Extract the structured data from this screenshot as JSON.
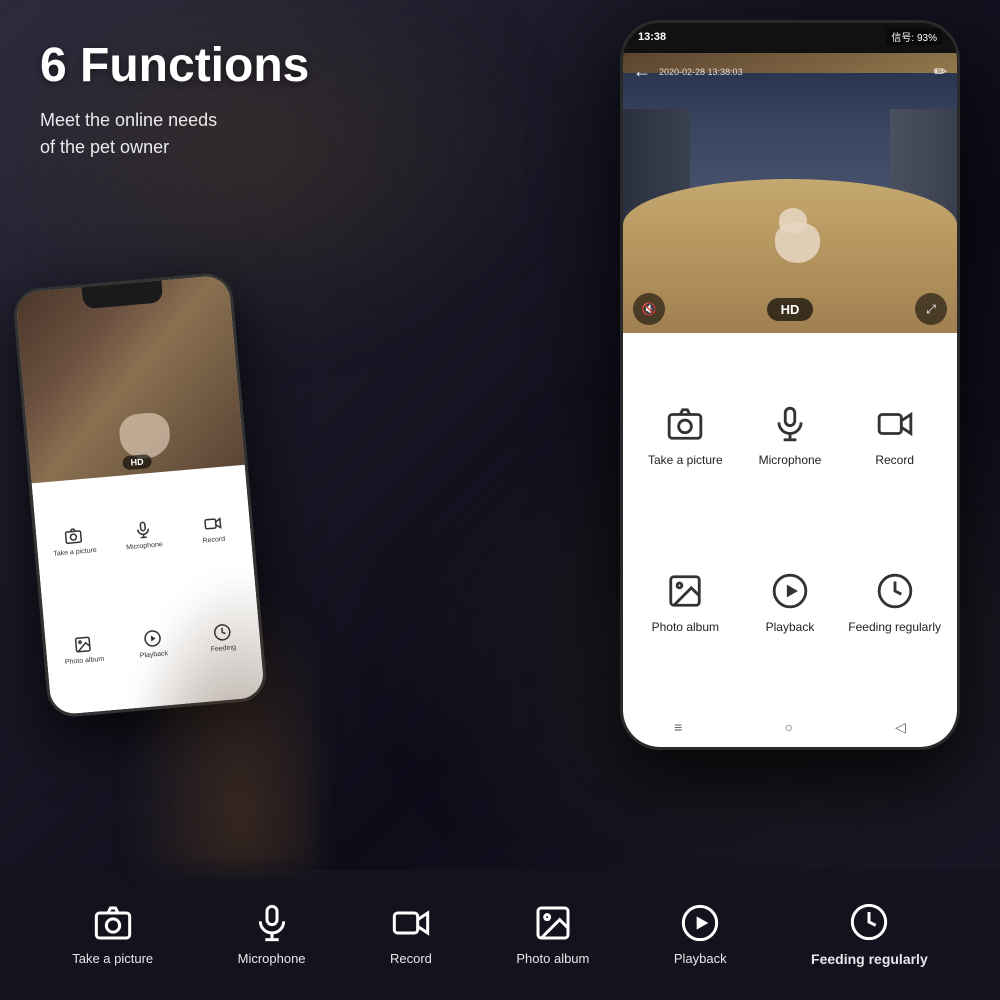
{
  "page": {
    "title": "6 Functions",
    "subtitle_line1": "Meet the online needs",
    "subtitle_line2": "of the pet owner"
  },
  "phone_main": {
    "statusbar": {
      "time": "13:38",
      "signal": "信号: 93%"
    },
    "camera": {
      "timestamp": "2020-02-28 13:38:03",
      "hd_label": "HD"
    },
    "functions": [
      {
        "id": "take-picture",
        "label": "Take a picture"
      },
      {
        "id": "microphone",
        "label": "Microphone"
      },
      {
        "id": "record",
        "label": "Record"
      },
      {
        "id": "photo-album",
        "label": "Photo album"
      },
      {
        "id": "playback",
        "label": "Playback"
      },
      {
        "id": "feeding",
        "label": "Feeding regularly"
      }
    ],
    "nav": {
      "menu": "≡",
      "home": "○",
      "back": "◁"
    }
  },
  "phone_small": {
    "hd_label": "HD",
    "functions": [
      {
        "id": "take-picture",
        "label": "Take a picture"
      },
      {
        "id": "microphone",
        "label": "Microphone"
      },
      {
        "id": "record",
        "label": "Record"
      },
      {
        "id": "photo-album",
        "label": "Photo album"
      },
      {
        "id": "playback",
        "label": "Playback"
      },
      {
        "id": "feeding",
        "label": "Feeding regularly"
      }
    ]
  },
  "bottom_bar": {
    "items": [
      {
        "id": "take-picture",
        "label": "Take a picture",
        "bold": false
      },
      {
        "id": "microphone",
        "label": "Microphone",
        "bold": false
      },
      {
        "id": "record",
        "label": "Record",
        "bold": false
      },
      {
        "id": "photo-album",
        "label": "Photo album",
        "bold": false
      },
      {
        "id": "playback",
        "label": "Playback",
        "bold": false
      },
      {
        "id": "feeding",
        "label": "Feeding regularly",
        "bold": true
      }
    ]
  },
  "colors": {
    "background": "#1a1a2e",
    "phone_body": "#111111",
    "white": "#ffffff",
    "icon_color": "#333333"
  }
}
